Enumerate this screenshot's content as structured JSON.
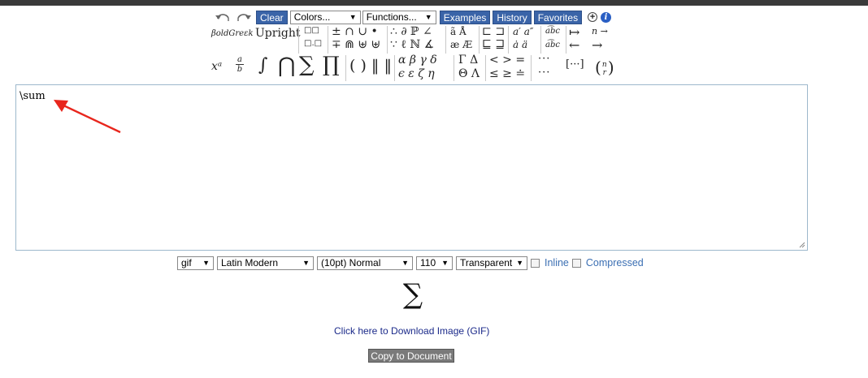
{
  "toolbar": {
    "undo_icon": "undo-icon",
    "redo_icon": "redo-icon",
    "clear_label": "Clear",
    "colors_label": "Colors...",
    "functions_label": "Functions...",
    "examples_label": "Examples",
    "history_label": "History",
    "favorites_label": "Favorites",
    "add_icon": "plus-icon",
    "info_icon": "info-icon",
    "accent_color": "#3a64a8"
  },
  "palette": {
    "bold_greek": "βoldGreεk",
    "upright": "Upright",
    "boxes_a": "□□",
    "boxes_b": "□.□",
    "ops1_top": "± ∩ ∪ •",
    "ops1_bot": "∓ ⋒ ⊎ ⊎",
    "rel_top": "∴ ∂ ℙ ∠",
    "rel_bot": "∵ ℓ ℕ ∡",
    "acc1_top": "ã  Å",
    "acc1_bot": "æ  Æ",
    "sub_top": "⊏ ⊐",
    "sub_bot": "⊑ ⊒",
    "prime_top": "a′  a″",
    "prime_bot": "ȧ  ä",
    "wide_top": "a͡bc",
    "wide_bot": "a͡bc",
    "arrows_top": "↦",
    "arrows_bot": "←",
    "arrows2_top": "n →",
    "arrows2_bot": "→",
    "superscript": "xᵃ",
    "frac_num": "a",
    "frac_den": "b",
    "integral": "∫",
    "bigcap": "⋂",
    "sum": "∑",
    "prod": "∏",
    "parens": "( ) ‖ ‖",
    "greek_top": "α  β  γ  δ",
    "greek_bot": "ϵ  ε  ζ  η",
    "greek_cap_top": "Γ  Δ",
    "greek_cap_bot": "Θ  Λ",
    "ineq_top": "<  >  =",
    "ineq_bot": "≤  ≥  ≐",
    "dots_top": "···",
    "dots_bot": "···",
    "matrix": "[···]",
    "binom_n": "n",
    "binom_r": "r"
  },
  "editor": {
    "content": "\\sum"
  },
  "options": {
    "format": "gif",
    "font": "Latin Modern",
    "size": "(10pt) Normal",
    "dpi": "110",
    "background": "Transparent",
    "inline_label": "Inline",
    "compressed_label": "Compressed"
  },
  "preview": {
    "rendered": "∑"
  },
  "download_label": "Click here to Download Image (GIF)",
  "copy_label": "Copy to Document",
  "annotation_color": "#e8261d"
}
